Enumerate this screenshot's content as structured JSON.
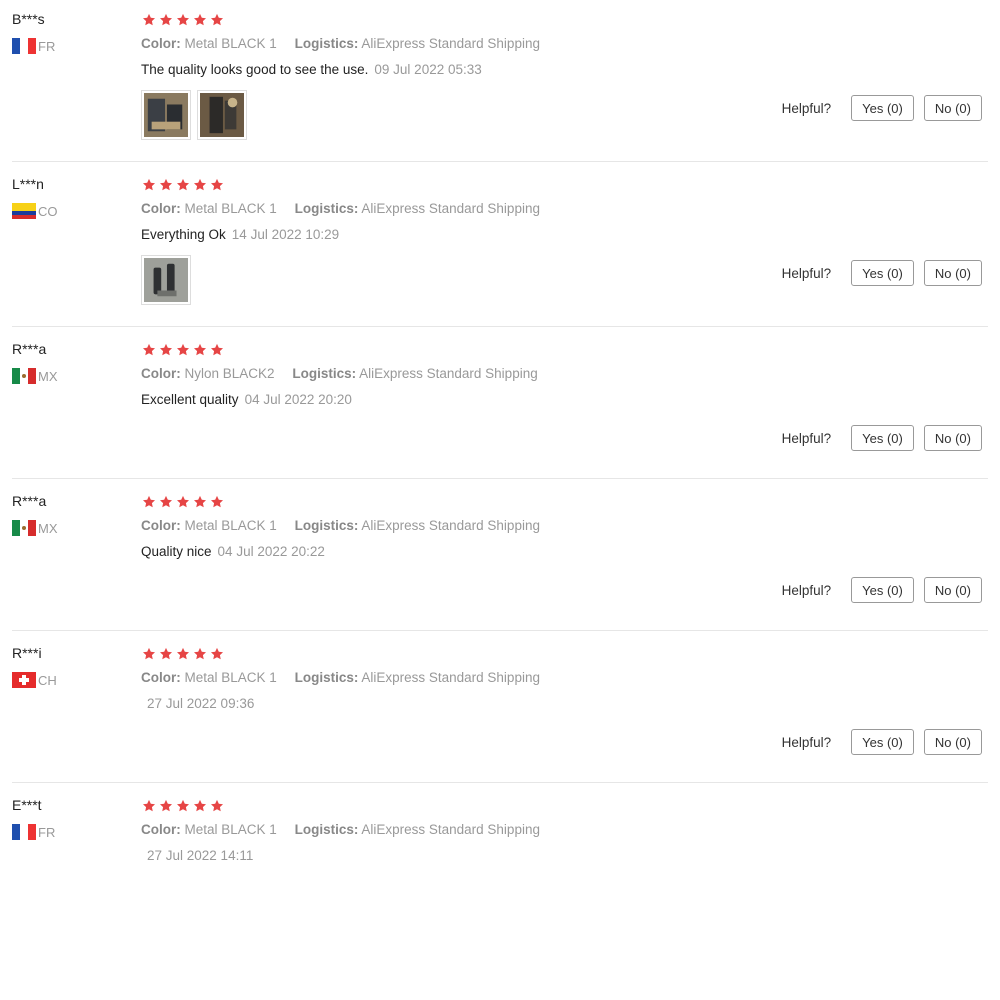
{
  "colors": {
    "star": "#e64545",
    "divider": "#e6e6e6",
    "muted": "#999999",
    "text": "#222222"
  },
  "labels": {
    "color": "Color:",
    "logistics": "Logistics:",
    "helpful": "Helpful?",
    "yes": "Yes (0)",
    "no": "No (0)"
  },
  "reviews": [
    {
      "user": "B***s",
      "country": "FR",
      "flag": "flag-france-icon",
      "rating": 5,
      "color": "Metal BLACK 1",
      "logistics": "AliExpress Standard Shipping",
      "text": "The quality looks good to see the use.",
      "date": "09 Jul 2022 05:33",
      "photos": [
        "review-photo-1",
        "review-photo-2"
      ],
      "helpful": true
    },
    {
      "user": "L***n",
      "country": "CO",
      "flag": "flag-colombia-icon",
      "rating": 5,
      "color": "Metal BLACK 1",
      "logistics": "AliExpress Standard Shipping",
      "text": "Everything Ok",
      "date": "14 Jul 2022 10:29",
      "photos": [
        "review-photo-1"
      ],
      "helpful": true
    },
    {
      "user": "R***a",
      "country": "MX",
      "flag": "flag-mexico-icon",
      "rating": 5,
      "color": "Nylon BLACK2",
      "logistics": "AliExpress Standard Shipping",
      "text": "Excellent quality",
      "date": "04 Jul 2022 20:20",
      "photos": [],
      "helpful": true
    },
    {
      "user": "R***a",
      "country": "MX",
      "flag": "flag-mexico-icon",
      "rating": 5,
      "color": "Metal BLACK 1",
      "logistics": "AliExpress Standard Shipping",
      "text": "Quality nice",
      "date": "04 Jul 2022 20:22",
      "photos": [],
      "helpful": true
    },
    {
      "user": "R***i",
      "country": "CH",
      "flag": "flag-switzerland-icon",
      "rating": 5,
      "color": "Metal BLACK 1",
      "logistics": "AliExpress Standard Shipping",
      "text": "",
      "date": "27 Jul 2022 09:36",
      "photos": [],
      "helpful": true
    },
    {
      "user": "E***t",
      "country": "FR",
      "flag": "flag-france-icon",
      "rating": 5,
      "color": "Metal BLACK 1",
      "logistics": "AliExpress Standard Shipping",
      "text": "",
      "date": "27 Jul 2022 14:11",
      "photos": [],
      "helpful": false
    }
  ]
}
